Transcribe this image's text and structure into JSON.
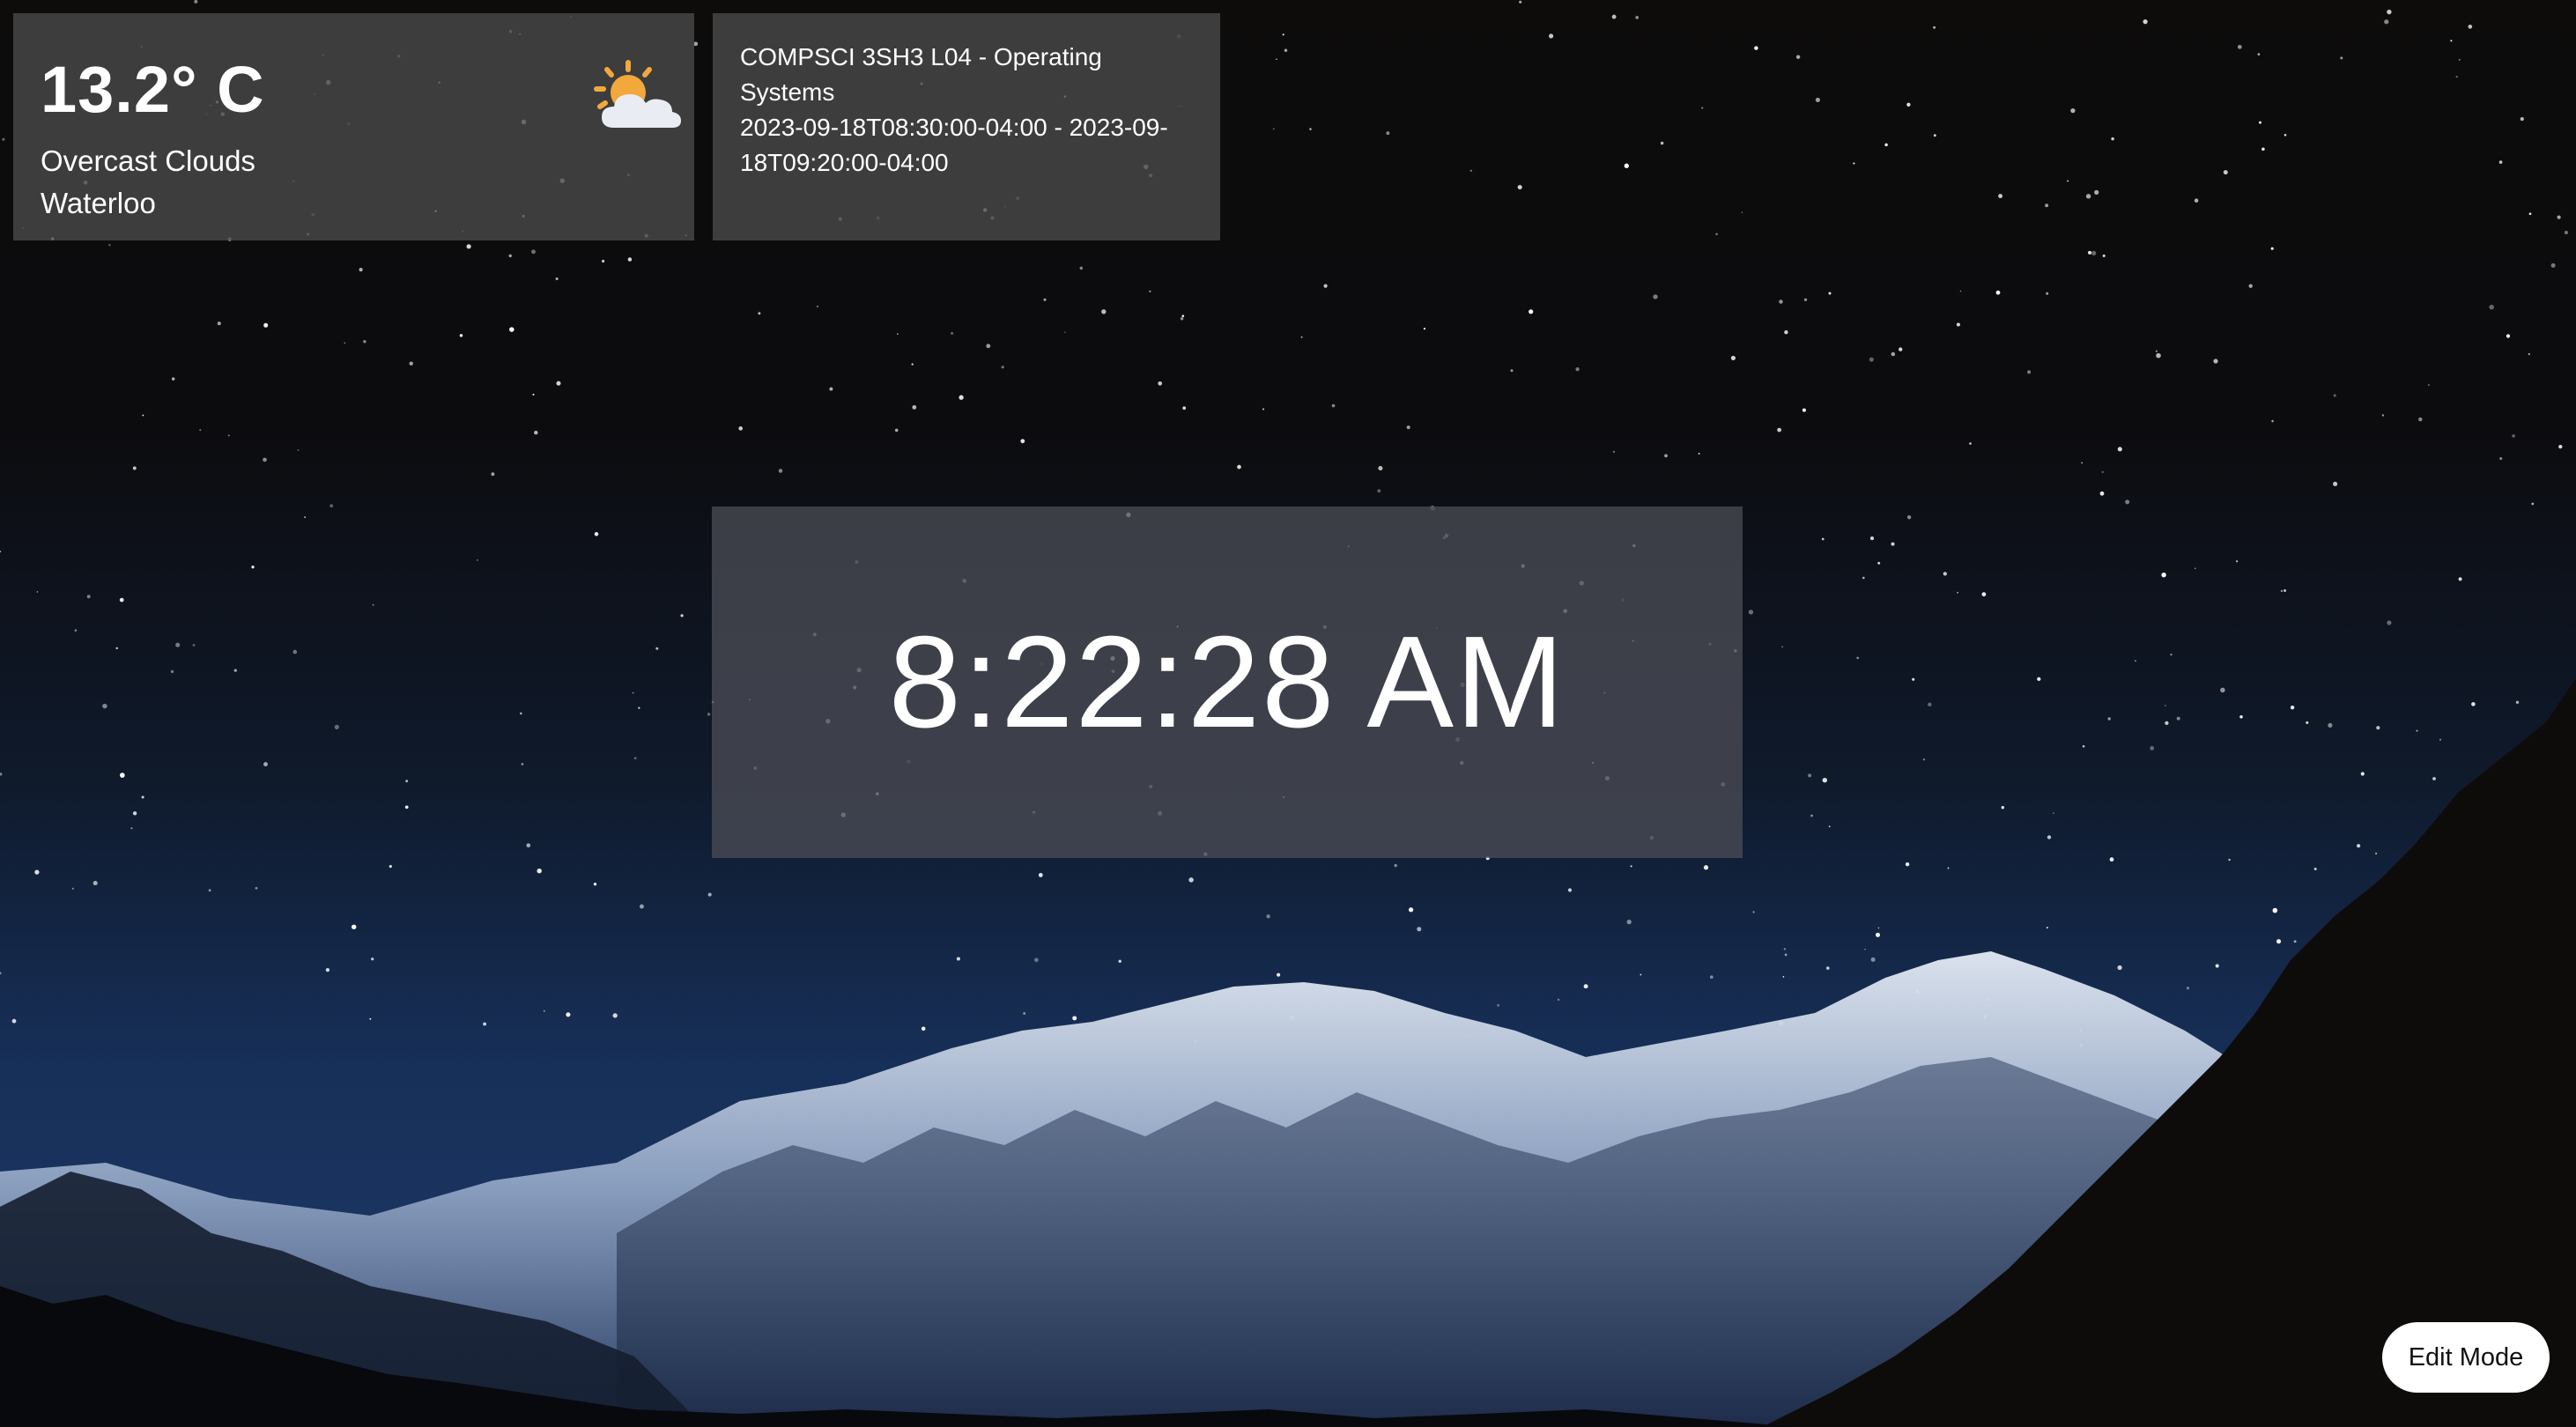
{
  "weather": {
    "temperature": "13.2° C",
    "condition": "Overcast Clouds",
    "location": "Waterloo",
    "icon": "partly-cloudy-sun-icon"
  },
  "event": {
    "title": "COMPSCI 3SH3 L04 - Operating Systems",
    "time_range": "2023-09-18T08:30:00-04:00 - 2023-09-18T09:20:00-04:00"
  },
  "clock": {
    "time": "8:22:28 AM"
  },
  "actions": {
    "edit_mode_label": "Edit Mode"
  },
  "background": {
    "description_icon": "night-mountain-wallpaper",
    "sky_color": "#0c0c0f",
    "mountain_snow_color": "#c9d3e2",
    "silhouette_color": "#0e0c0a"
  }
}
